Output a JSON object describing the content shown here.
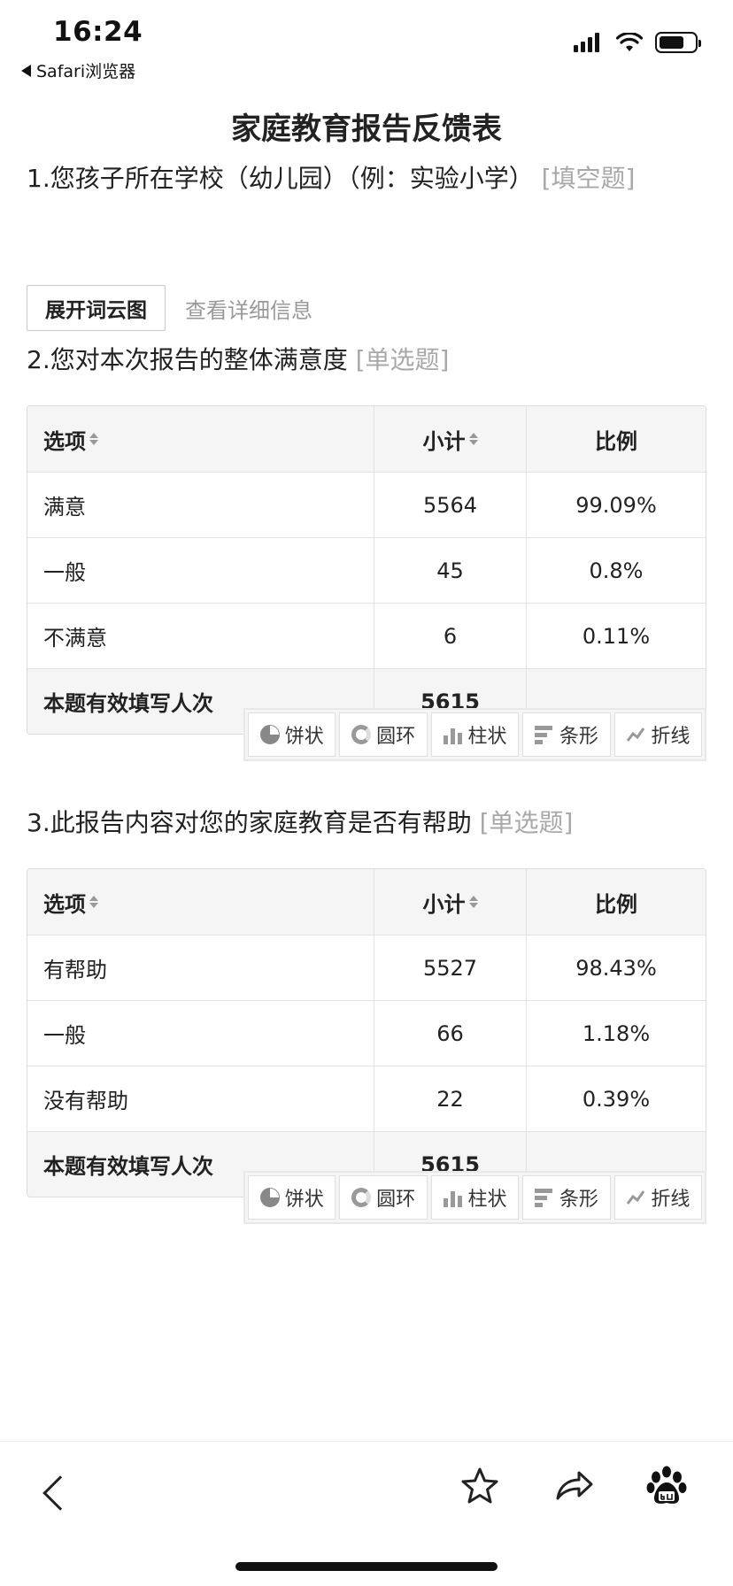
{
  "status_bar": {
    "time": "16:24",
    "back_app_label": "Safari浏览器"
  },
  "page": {
    "title": "家庭教育报告反馈表"
  },
  "questions": [
    {
      "title": "1.您孩子所在学校（幼儿园）（例：实验小学）",
      "type": "[填空题]",
      "wordcloud_button": "展开词云图",
      "detail_link": "查看详细信息"
    },
    {
      "title": "2.您对本次报告的整体满意度",
      "type": "[单选题]",
      "headers": [
        "选项",
        "小计",
        "比例"
      ],
      "rows": [
        {
          "option": "满意",
          "count": "5564",
          "pct": "99.09%"
        },
        {
          "option": "一般",
          "count": "45",
          "pct": "0.8%"
        },
        {
          "option": "不满意",
          "count": "6",
          "pct": "0.11%"
        }
      ],
      "total_label": "本题有效填写人次",
      "total_count": "5615"
    },
    {
      "title": "3.此报告内容对您的家庭教育是否有帮助",
      "type": "[单选题]",
      "headers": [
        "选项",
        "小计",
        "比例"
      ],
      "rows": [
        {
          "option": "有帮助",
          "count": "5527",
          "pct": "98.43%"
        },
        {
          "option": "一般",
          "count": "66",
          "pct": "1.18%"
        },
        {
          "option": "没有帮助",
          "count": "22",
          "pct": "0.39%"
        }
      ],
      "total_label": "本题有效填写人次",
      "total_count": "5615"
    }
  ],
  "chart_types": [
    {
      "label": "饼状",
      "icon": "pie-chart-icon"
    },
    {
      "label": "圆环",
      "icon": "ring-chart-icon"
    },
    {
      "label": "柱状",
      "icon": "column-chart-icon"
    },
    {
      "label": "条形",
      "icon": "bar-chart-icon"
    },
    {
      "label": "折线",
      "icon": "line-chart-icon"
    }
  ],
  "bottom_bar": {
    "icons": [
      "back-icon",
      "favorite-star-icon",
      "share-icon",
      "baidu-icon"
    ]
  }
}
